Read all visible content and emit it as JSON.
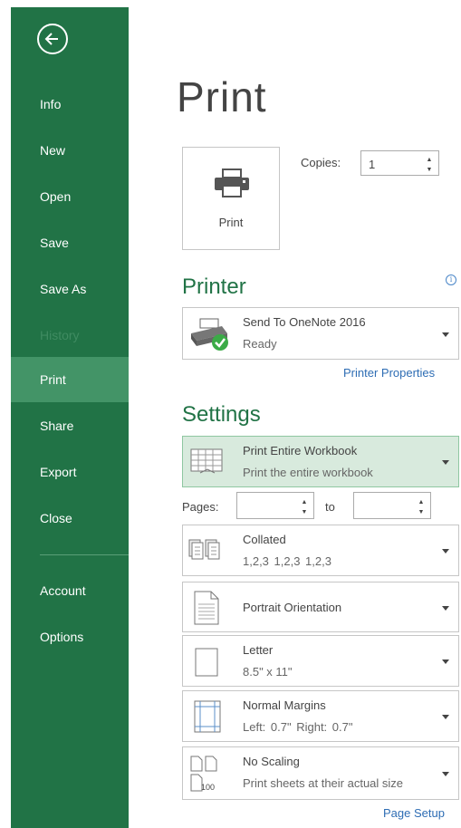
{
  "sidebar": {
    "items": [
      {
        "label": "Info"
      },
      {
        "label": "New"
      },
      {
        "label": "Open"
      },
      {
        "label": "Save"
      },
      {
        "label": "Save As"
      },
      {
        "label": "History"
      },
      {
        "label": "Print"
      },
      {
        "label": "Share"
      },
      {
        "label": "Export"
      },
      {
        "label": "Close"
      },
      {
        "label": "Account"
      },
      {
        "label": "Options"
      }
    ],
    "active": "Print"
  },
  "main": {
    "title": "Print",
    "print_button_label": "Print",
    "copies_label": "Copies:",
    "copies_value": "1"
  },
  "printer": {
    "heading": "Printer",
    "name": "Send To OneNote 2016",
    "status": "Ready",
    "properties_link": "Printer Properties"
  },
  "settings": {
    "heading": "Settings",
    "what": {
      "title": "Print Entire Workbook",
      "subtitle": "Print the entire workbook"
    },
    "pages_label": "Pages:",
    "to_label": "to",
    "collation": {
      "title": "Collated",
      "subtitle": "1,2,3    1,2,3    1,2,3"
    },
    "orientation": {
      "title": "Portrait Orientation"
    },
    "paper": {
      "title": "Letter",
      "subtitle": "8.5\" x 11\""
    },
    "margins": {
      "title": "Normal Margins",
      "subtitle": "Left: 0.7\"    Right: 0.7\""
    },
    "scaling": {
      "title": "No Scaling",
      "subtitle": "Print sheets at their actual size",
      "icon_text": "100"
    },
    "page_setup_link": "Page Setup"
  },
  "colors": {
    "sidebar": "#217346",
    "sidebar_active": "#439467",
    "accent": "#217346",
    "link": "#2e6db4"
  }
}
